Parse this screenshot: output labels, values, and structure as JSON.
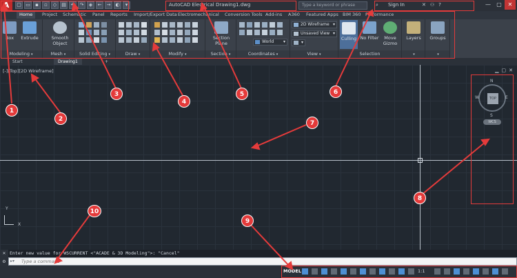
{
  "app": {
    "logo": "A",
    "title": "AutoCAD Electrical  Drawing1.dwg",
    "search_placeholder": "Type a keyword or phrase",
    "sign_in": "Sign In"
  },
  "ribbon_tabs": [
    "Home",
    "Project",
    "Schematic",
    "Panel",
    "Reports",
    "Import/Export Data",
    "Electromechanical",
    "Conversion Tools",
    "Add-ins",
    "A360",
    "Featured Apps",
    "BIM 360",
    "Performance"
  ],
  "ribbon": {
    "panels": {
      "modeling": "Modeling",
      "mesh": "Mesh",
      "solid_editing": "Solid Editing",
      "draw": "Draw",
      "modify": "Modify",
      "section": "Section",
      "coordinates": "Coordinates",
      "view": "View",
      "selection": "Selection"
    },
    "tools": {
      "box": "Box",
      "extrude": "Extrude",
      "smooth_object": "Smooth Object",
      "section_plane": "Section Plane",
      "culling": "Culling",
      "no_filter": "No Filter",
      "move_gizmo": "Move Gizmo",
      "layers": "Layers",
      "groups": "Groups"
    },
    "visual_style": "2D Wireframe",
    "saved_view": "Unsaved View",
    "ucs": "World"
  },
  "doc_tabs": [
    "Start",
    "Drawing1"
  ],
  "viewport": {
    "label": "[-][Top][2D Wireframe]",
    "cube_face": "TOP",
    "compass": {
      "n": "N",
      "s": "S",
      "e": "E",
      "w": "W"
    },
    "wcs": "WCS",
    "ucs_x": "X",
    "ucs_y": "Y"
  },
  "command": {
    "history": "Enter new value for WSCURRENT <\"ACADE & 3D Modeling\">: \"Cancel\"",
    "placeholder": "Type a command"
  },
  "status": {
    "model": "MODEL",
    "scale": "1:1"
  },
  "callouts": [
    "1",
    "2",
    "3",
    "4",
    "5",
    "6",
    "7",
    "8",
    "9",
    "10"
  ]
}
